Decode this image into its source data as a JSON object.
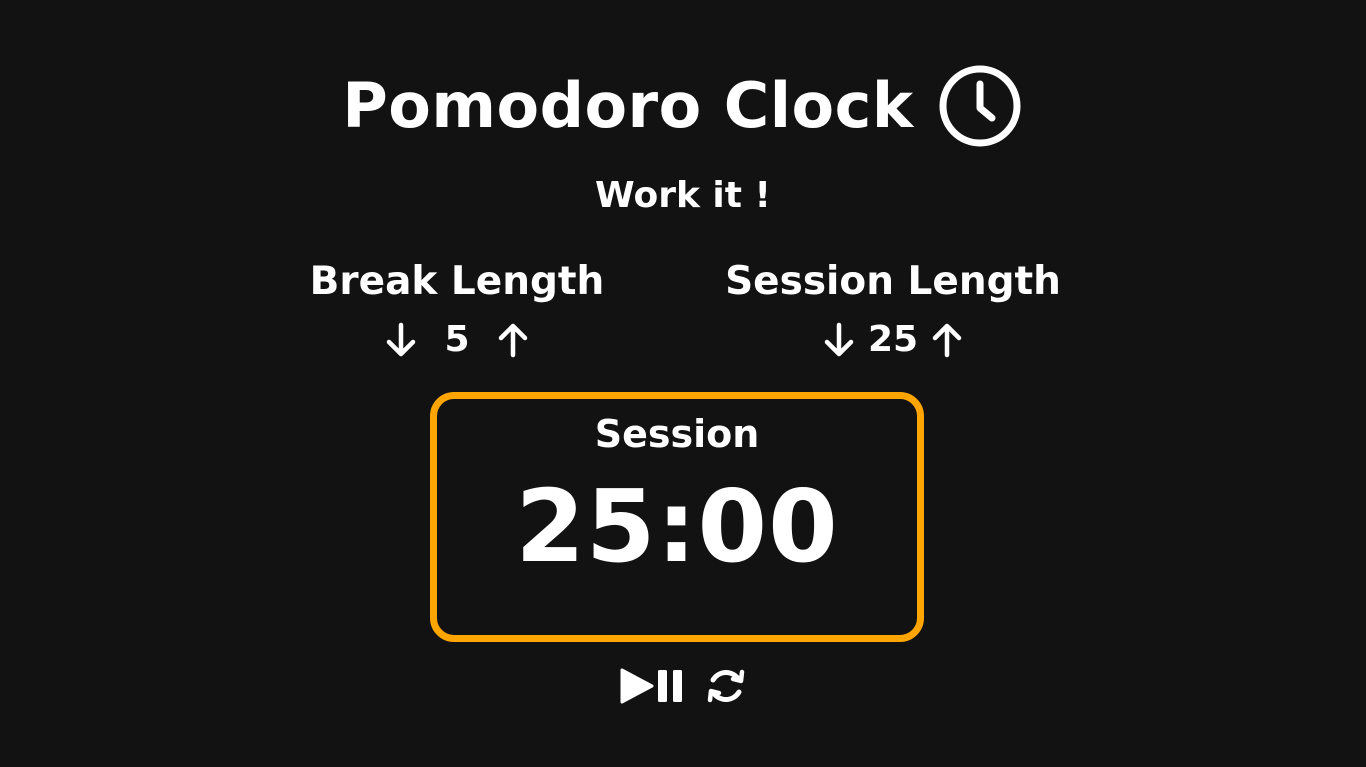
{
  "app": {
    "title": "Pomodoro Clock",
    "title_icon": "clock-icon",
    "subtitle": "Work it !"
  },
  "break": {
    "label": "Break Length",
    "value": "5",
    "decrement_icon": "arrow-down-icon",
    "increment_icon": "arrow-up-icon"
  },
  "session": {
    "label": "Session Length",
    "value": "25",
    "decrement_icon": "arrow-down-icon",
    "increment_icon": "arrow-up-icon"
  },
  "timer": {
    "label": "Session",
    "time_left": "25:00"
  },
  "controls": {
    "start_stop_icon": "play-pause-icon",
    "reset_icon": "refresh-icon"
  },
  "colors": {
    "background": "#121212",
    "text": "#ffffff",
    "accent": "#ffa500"
  }
}
